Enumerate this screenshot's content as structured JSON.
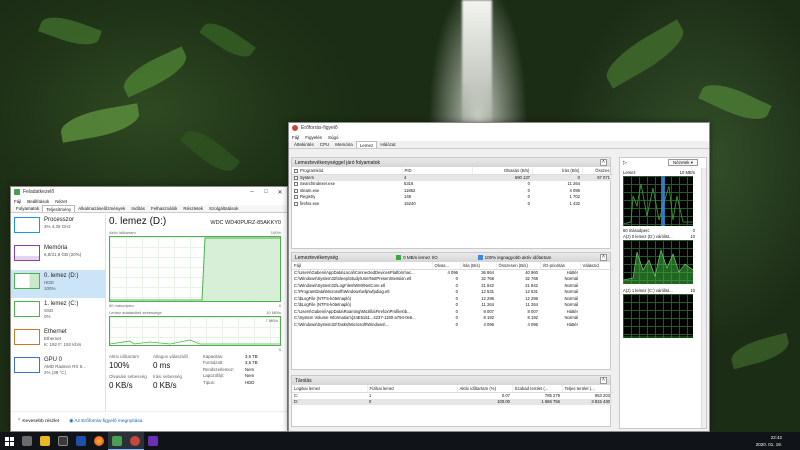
{
  "colors": {
    "disk_green": "#4cb04c",
    "cpu_blue": "#1a9bd7",
    "mem_purple": "#8b3fa8",
    "net_orange": "#c9782b",
    "gpu_blue": "#3b74c4",
    "graph_bg_black": "#000000",
    "io_green": "#3aa83a",
    "queue_blue": "#3b8be0"
  },
  "task_manager": {
    "title": "Feladatkezelő",
    "menu": [
      "Fájl",
      "Beállítások",
      "Nézet"
    ],
    "tabs": [
      "Folyamatok",
      "Teljesítmény",
      "Alkalmazáselőzmények",
      "Indítás",
      "Felhasználók",
      "Részletek",
      "Szolgáltatások"
    ],
    "sidebar": [
      {
        "name": "Processzor",
        "sub1": "3% 4,35 GHz",
        "sub2": "",
        "icon": "cpu-graph-icon"
      },
      {
        "name": "Memória",
        "sub1": "6,8/31,9 GB (20%)",
        "sub2": "",
        "icon": "memory-graph-icon"
      },
      {
        "name": "0. lemez (D:)",
        "sub1": "HDD",
        "sub2": "100%",
        "icon": "disk-graph-icon"
      },
      {
        "name": "1. lemez (C:)",
        "sub1": "SSD",
        "sub2": "0%",
        "icon": "disk-graph-icon"
      },
      {
        "name": "Ethernet",
        "sub1": "Ethernet",
        "sub2": "K: 192 F: 192 Kb/s",
        "icon": "ethernet-graph-icon"
      },
      {
        "name": "GPU 0",
        "sub1": "AMD Radeon RX 5...",
        "sub2": "2% (39 °C)",
        "icon": "gpu-graph-icon"
      }
    ],
    "detail": {
      "title": "0. lemez (D:)",
      "model": "WDC WD40PURZ-85AKKY0",
      "graph1_label_left": "Aktív időtartam",
      "graph1_label_right": "100%",
      "graph1_bottom_left": "60 másodperc",
      "graph1_bottom_right": "0",
      "graph2_label_left": "Lemez adatátviteli sebessége",
      "graph2_label_right": "10 MB/s",
      "graph2_sub_right": "7 MB/s",
      "graph2_bottom_right": "0",
      "active_time_label": "Aktív időtartam",
      "active_time_value": "100%",
      "response_label": "Átlagos válaszidő",
      "response_value": "0 ms",
      "read_label": "Olvasási sebesség",
      "read_value": "0 KB/s",
      "write_label": "Írási sebesség",
      "write_value": "0 KB/s",
      "props": [
        {
          "k": "Kapacitás:",
          "v": "3,6 TB"
        },
        {
          "k": "Formázott:",
          "v": "3,6 TB"
        },
        {
          "k": "Rendszerlemez:",
          "v": "Nem"
        },
        {
          "k": "Lapozófájl:",
          "v": "Nem"
        },
        {
          "k": "Típus:",
          "v": "HDD"
        }
      ]
    },
    "footer_less": "Kevesebb részlet",
    "footer_link": "Az Erőforrás-figyelő megnyitása"
  },
  "resource_monitor": {
    "title": "Erőforrás-figyelő",
    "menu": [
      "Fájl",
      "Figyelés",
      "Súgó"
    ],
    "tabs": [
      "Áttekintés",
      "CPU",
      "Memória",
      "Lemez",
      "Hálózat"
    ],
    "proc_section": {
      "title": "Lemeztevékenységgel járó folyamatok",
      "columns": [
        "Programkód",
        "PID",
        "Olvasás (B/s)",
        "Írás (B/s)",
        "Összes"
      ],
      "rows": [
        [
          "System",
          "4",
          "590 137",
          "0",
          "67 071"
        ],
        [
          "SearchIndexer.exe",
          "5316",
          "0",
          "11 264",
          ""
        ],
        [
          "steam.exe",
          "11852",
          "0",
          "4 096",
          ""
        ],
        [
          "Registry",
          "148",
          "0",
          "1 702",
          ""
        ],
        [
          "firefox.exe",
          "15240",
          "0",
          "1 432",
          ""
        ]
      ]
    },
    "disk_section": {
      "title": "Lemeztevékenység",
      "io_label": "0 MB/s lemez I/O",
      "active_label": "100% legnagyobb aktív időtartam",
      "columns": [
        "Fájl",
        "Olvas...",
        "Írás (B/s)",
        "Összesen (B/s)",
        "I/O-prioritás",
        "Válaszid"
      ],
      "rows": [
        [
          "C:\\Users\\Gabeni\\AppData\\Local\\ConnectedDevicesPlatform\\ac...",
          "4 096",
          "36 864",
          "40 960",
          "Háttér"
        ],
        [
          "C:\\Windows\\System32\\Sleep\\Study\\UserNotPresentSession.etl",
          "0",
          "32 768",
          "32 768",
          "Normál"
        ],
        [
          "C:\\Windows\\System32\\LogFiles\\WMI\\NetCore.etl",
          "0",
          "21 842",
          "21 842",
          "Normál"
        ],
        [
          "C:\\ProgramData\\Microsoft\\Windows\\wfp\\wfpdiag.etl",
          "0",
          "12 531",
          "12 531",
          "Normál"
        ],
        [
          "C:\\$LogFile (NTFS-kötetnapló)",
          "0",
          "12 296",
          "12 296",
          "Normál"
        ],
        [
          "C:\\$LogFile (NTFS-kötetnapló)",
          "0",
          "11 264",
          "11 264",
          "Normál"
        ],
        [
          "C:\\Users\\Gabeni\\AppData\\Roaming\\Mozilla\\Firefox\\Profiles\\b...",
          "0",
          "8 007",
          "8 007",
          "Háttér"
        ],
        [
          "C:\\System Volume Information\\{24E5151...4237-1190-a794-0e6...",
          "0",
          "8 192",
          "8 192",
          "Normál"
        ],
        [
          "C:\\Windows\\System32\\Tasks\\Microsoft\\Windows\\...",
          "0",
          "4 096",
          "4 096",
          "Háttér"
        ]
      ]
    },
    "storage_section": {
      "title": "Tárolás",
      "columns": [
        "Logikai lemez",
        "Fizikai lemez",
        "Aktív időtartam (%)",
        "Szabad terület (...",
        "Teljes terület (..."
      ],
      "rows": [
        [
          "C:",
          "1",
          "0.07",
          "785 279",
          "953 203"
        ],
        [
          "D:",
          "0",
          "100.00",
          "1 666 756",
          "3 815 430"
        ]
      ]
    },
    "side": {
      "views_label": "Nézetek",
      "disk_label": "Lemez",
      "disk_max": "10 MB/s",
      "graph1_bottom_left": "60 másodperc",
      "graph1_bottom_right": "0",
      "q1_label": "A(z) 0 lemez (D:) várólist...",
      "q1_max": "10",
      "q2_label": "A(z) 1 lemez (C:) várólist...",
      "q2_max": "10"
    }
  },
  "taskbar": {
    "time": "22:42",
    "date": "2020. 01. 19."
  }
}
